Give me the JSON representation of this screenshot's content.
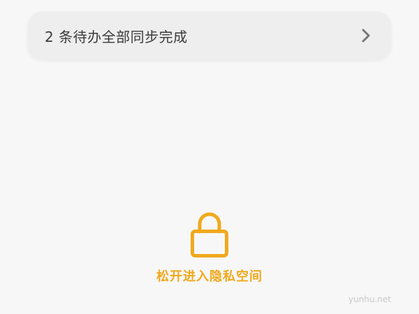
{
  "sync_banner": {
    "text": "2 条待办全部同步完成",
    "icon": "chevron-right-icon"
  },
  "private_space": {
    "icon": "lock-icon",
    "hint": "松开进入隐私空间",
    "accent_color": "#f0a91c"
  },
  "watermark": {
    "text": "yunhu.net"
  }
}
